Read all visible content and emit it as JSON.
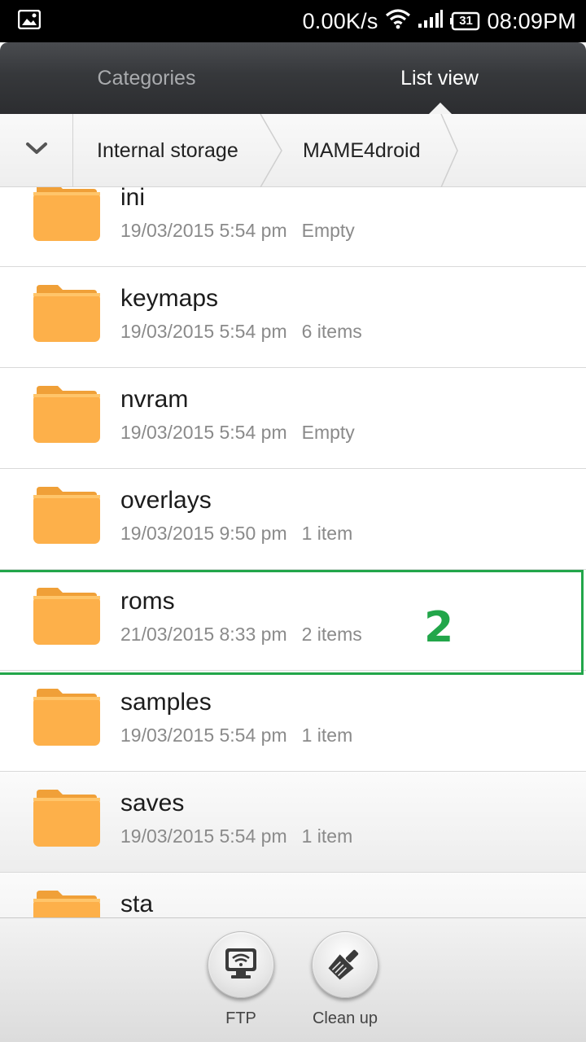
{
  "status_bar": {
    "net_speed": "0.00K/s",
    "battery": "31",
    "time": "08:09PM"
  },
  "tabs": {
    "categories": "Categories",
    "list_view": "List view"
  },
  "breadcrumb": {
    "items": [
      "Internal storage",
      "MAME4droid"
    ]
  },
  "files": [
    {
      "name": "ini",
      "date": "19/03/2015 5:54 pm",
      "count": "Empty"
    },
    {
      "name": "keymaps",
      "date": "19/03/2015 5:54 pm",
      "count": "6 items"
    },
    {
      "name": "nvram",
      "date": "19/03/2015 5:54 pm",
      "count": "Empty"
    },
    {
      "name": "overlays",
      "date": "19/03/2015 9:50 pm",
      "count": "1 item"
    },
    {
      "name": "roms",
      "date": "21/03/2015 8:33 pm",
      "count": "2 items"
    },
    {
      "name": "samples",
      "date": "19/03/2015 5:54 pm",
      "count": "1 item"
    },
    {
      "name": "saves",
      "date": "19/03/2015 5:54 pm",
      "count": "1 item"
    },
    {
      "name": "sta",
      "date": "",
      "count": ""
    }
  ],
  "annotation": {
    "label": "2",
    "color": "#22a64a"
  },
  "bottom_actions": {
    "ftp": "FTP",
    "clean_up": "Clean up"
  },
  "colors": {
    "folder": "#fdb04a",
    "folder_tab": "#f0a038",
    "tab_bar": "#36383b"
  }
}
